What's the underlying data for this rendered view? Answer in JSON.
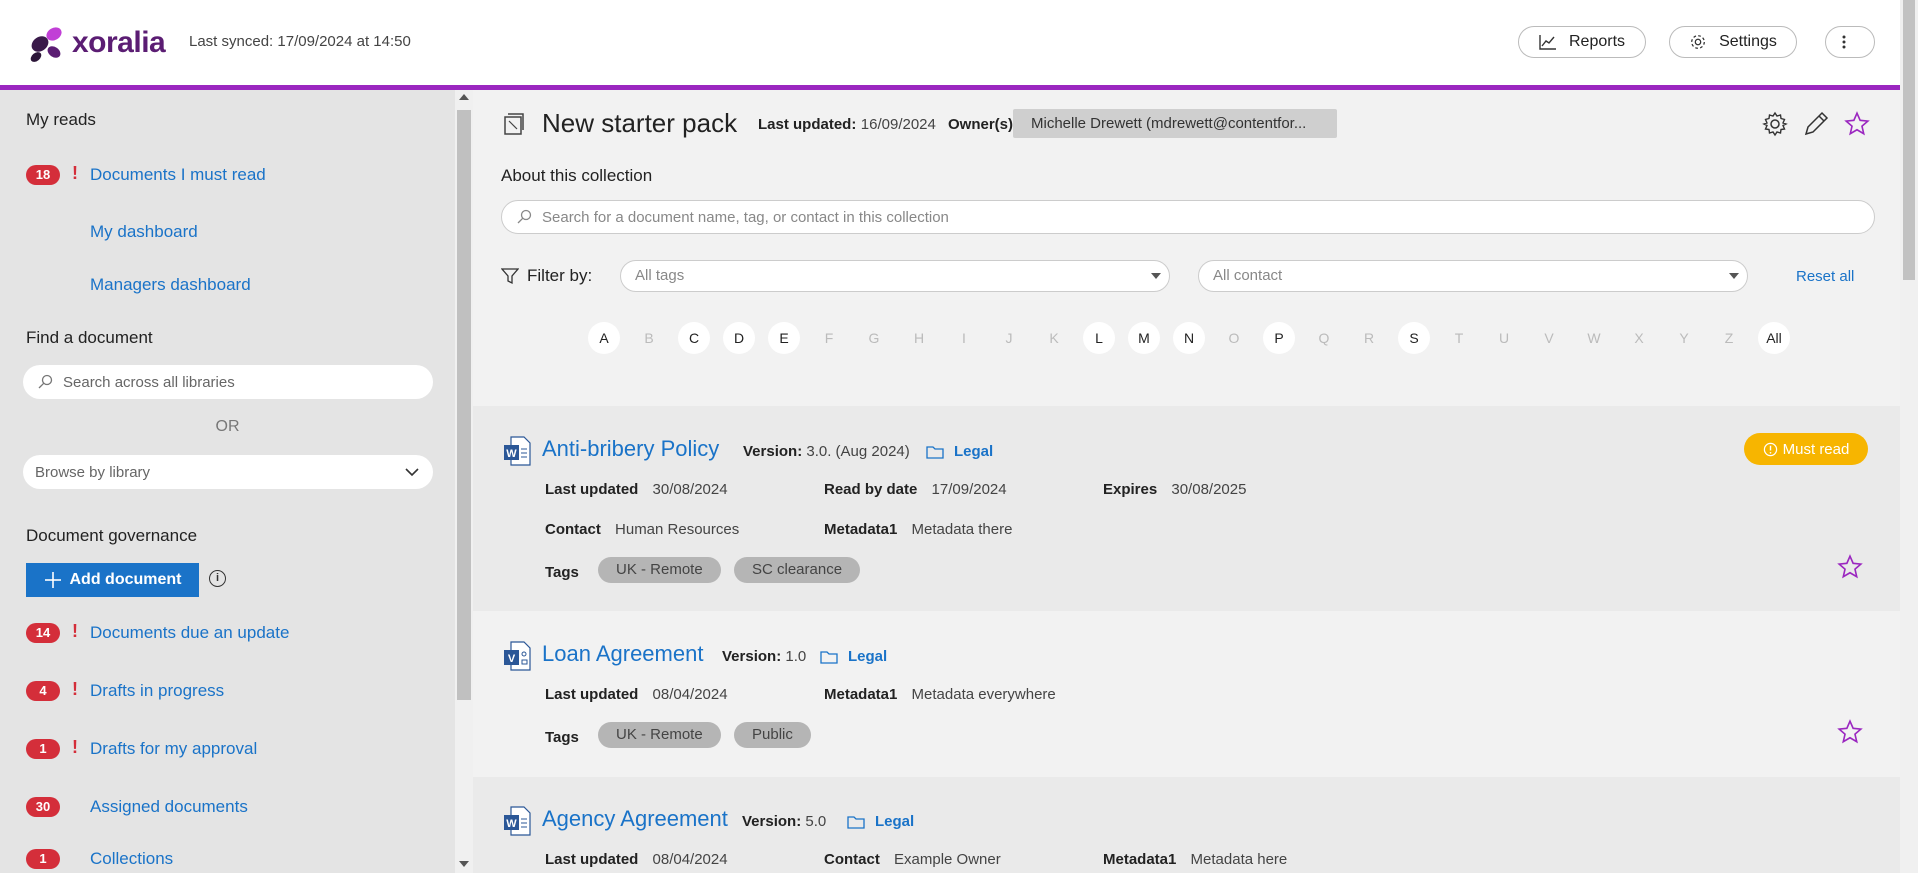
{
  "header": {
    "brand": "xoralia",
    "synced": "Last synced: 17/09/2024 at 14:50",
    "reports_label": "Reports",
    "settings_label": "Settings"
  },
  "sidebar": {
    "my_reads_heading": "My reads",
    "documents_must_read": {
      "count": "18",
      "label": "Documents I must read"
    },
    "my_dashboard": "My dashboard",
    "managers_dashboard": "Managers dashboard",
    "find_heading": "Find a document",
    "search_placeholder": "Search across all libraries",
    "or_label": "OR",
    "browse_label": "Browse by library",
    "governance_heading": "Document governance",
    "add_document": "Add document",
    "items": [
      {
        "count": "14",
        "label": "Documents due an update",
        "urgent": true
      },
      {
        "count": "4",
        "label": "Drafts in progress",
        "urgent": true
      },
      {
        "count": "1",
        "label": "Drafts for my approval",
        "urgent": true
      },
      {
        "count": "30",
        "label": "Assigned documents",
        "urgent": false
      },
      {
        "count": "1",
        "label": "Collections",
        "urgent": false
      }
    ]
  },
  "collection": {
    "title": "New starter pack",
    "last_updated_label": "Last updated:",
    "last_updated": "16/09/2024",
    "owner_label": "Owner(s)",
    "owner": "Michelle Drewett (mdrewett@contentfor...",
    "about_label": "About this collection",
    "search_placeholder": "Search for a document name, tag, or contact in this collection",
    "filter_label": "Filter by:",
    "tags_placeholder": "All tags",
    "contact_placeholder": "All contact",
    "reset_label": "Reset all",
    "letters": [
      {
        "l": "A",
        "on": true
      },
      {
        "l": "B",
        "on": false
      },
      {
        "l": "C",
        "on": true
      },
      {
        "l": "D",
        "on": true
      },
      {
        "l": "E",
        "on": true
      },
      {
        "l": "F",
        "on": false
      },
      {
        "l": "G",
        "on": false
      },
      {
        "l": "H",
        "on": false
      },
      {
        "l": "I",
        "on": false
      },
      {
        "l": "J",
        "on": false
      },
      {
        "l": "K",
        "on": false
      },
      {
        "l": "L",
        "on": true
      },
      {
        "l": "M",
        "on": true
      },
      {
        "l": "N",
        "on": true
      },
      {
        "l": "O",
        "on": false
      },
      {
        "l": "P",
        "on": true
      },
      {
        "l": "Q",
        "on": false
      },
      {
        "l": "R",
        "on": false
      },
      {
        "l": "S",
        "on": true
      },
      {
        "l": "T",
        "on": false
      },
      {
        "l": "U",
        "on": false
      },
      {
        "l": "V",
        "on": false
      },
      {
        "l": "W",
        "on": false
      },
      {
        "l": "X",
        "on": false
      },
      {
        "l": "Y",
        "on": false
      },
      {
        "l": "Z",
        "on": false
      },
      {
        "l": "All",
        "on": true
      }
    ]
  },
  "documents": [
    {
      "title": "Anti-bribery Policy",
      "version_label": "Version:",
      "version": "3.0. (Aug 2024)",
      "library": "Legal",
      "badge": "Must read",
      "last_updated_label": "Last updated",
      "last_updated": "30/08/2024",
      "read_by_label": "Read by date",
      "read_by": "17/09/2024",
      "expires_label": "Expires",
      "expires": "30/08/2025",
      "contact_label": "Contact",
      "contact": "Human Resources",
      "metadata_label": "Metadata1",
      "metadata": "Metadata there",
      "tags_label": "Tags",
      "tags": [
        "UK - Remote",
        "SC clearance"
      ]
    },
    {
      "title": "Loan Agreement",
      "version_label": "Version:",
      "version": "1.0",
      "library": "Legal",
      "last_updated_label": "Last updated",
      "last_updated": "08/04/2024",
      "metadata_label": "Metadata1",
      "metadata": "Metadata everywhere",
      "tags_label": "Tags",
      "tags": [
        "UK - Remote",
        "Public"
      ]
    },
    {
      "title": "Agency Agreement",
      "version_label": "Version:",
      "version": "5.0",
      "library": "Legal",
      "last_updated_label": "Last updated",
      "last_updated": "08/04/2024",
      "contact_label": "Contact",
      "contact": "Example Owner",
      "metadata_label": "Metadata1",
      "metadata": "Metadata here"
    }
  ]
}
